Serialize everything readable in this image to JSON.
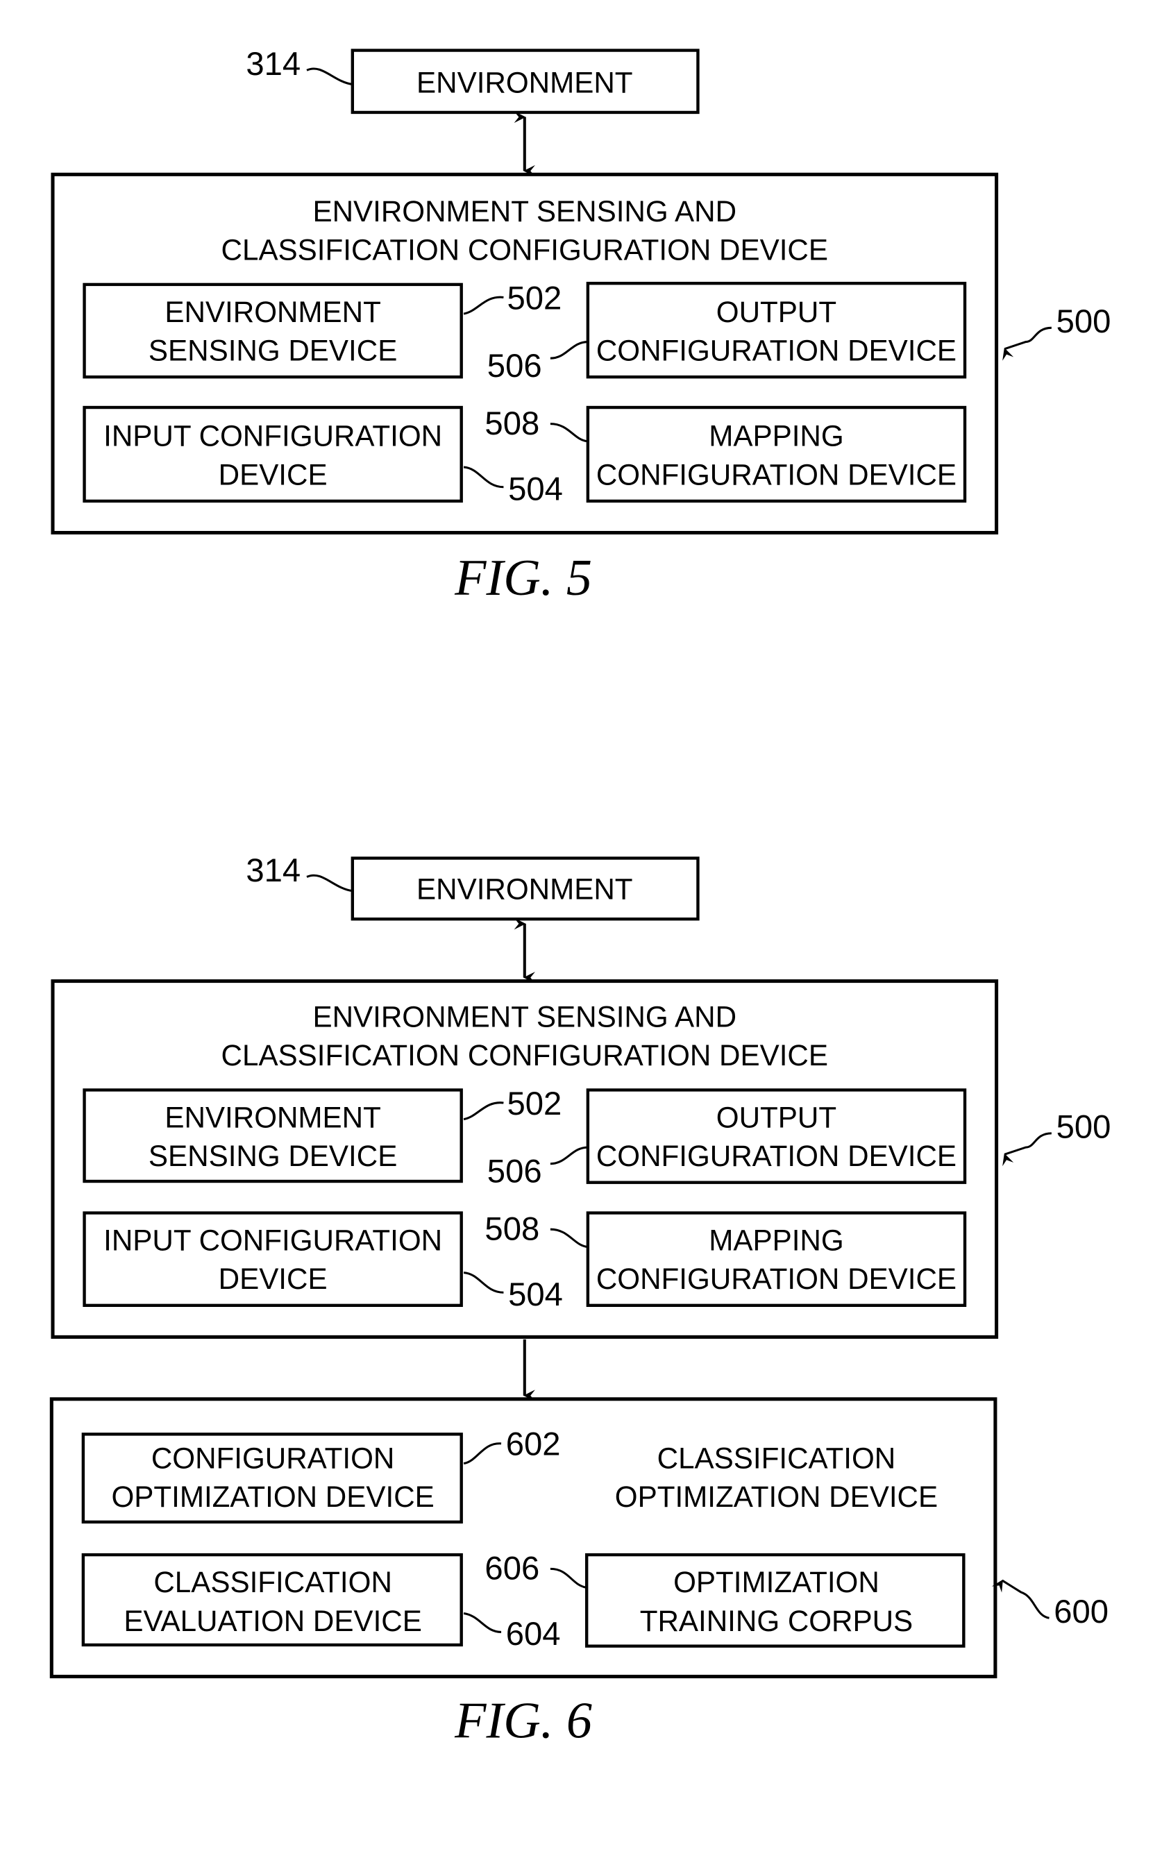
{
  "colors": {
    "ink": "#000000",
    "background": "#ffffff"
  },
  "figures": [
    {
      "caption": "FIG. 5",
      "environment": {
        "label": "ENVIRONMENT",
        "ref": "314"
      },
      "device": {
        "title_line1": "ENVIRONMENT SENSING AND",
        "title_line2": "CLASSIFICATION CONFIGURATION DEVICE",
        "ref": "500",
        "blocks": [
          {
            "line1": "ENVIRONMENT",
            "line2": "SENSING DEVICE",
            "ref": "502"
          },
          {
            "line1": "OUTPUT",
            "line2": "CONFIGURATION DEVICE",
            "ref": "506"
          },
          {
            "line1": "INPUT CONFIGURATION",
            "line2": "DEVICE",
            "ref": "504"
          },
          {
            "line1": "MAPPING",
            "line2": "CONFIGURATION DEVICE",
            "ref": "508"
          }
        ]
      }
    },
    {
      "caption": "FIG. 6",
      "environment": {
        "label": "ENVIRONMENT",
        "ref": "314"
      },
      "device": {
        "title_line1": "ENVIRONMENT SENSING AND",
        "title_line2": "CLASSIFICATION CONFIGURATION DEVICE",
        "ref": "500",
        "blocks": [
          {
            "line1": "ENVIRONMENT",
            "line2": "SENSING DEVICE",
            "ref": "502"
          },
          {
            "line1": "OUTPUT",
            "line2": "CONFIGURATION DEVICE",
            "ref": "506"
          },
          {
            "line1": "INPUT CONFIGURATION",
            "line2": "DEVICE",
            "ref": "504"
          },
          {
            "line1": "MAPPING",
            "line2": "CONFIGURATION DEVICE",
            "ref": "508"
          }
        ]
      },
      "optimizer": {
        "title_line1": "CLASSIFICATION",
        "title_line2": "OPTIMIZATION DEVICE",
        "ref": "600",
        "blocks": [
          {
            "line1": "CONFIGURATION",
            "line2": "OPTIMIZATION DEVICE",
            "ref": "602"
          },
          {
            "line1": "CLASSIFICATION",
            "line2": "EVALUATION DEVICE",
            "ref": "604"
          },
          {
            "line1": "OPTIMIZATION",
            "line2": "TRAINING CORPUS",
            "ref": "606"
          }
        ]
      }
    }
  ]
}
